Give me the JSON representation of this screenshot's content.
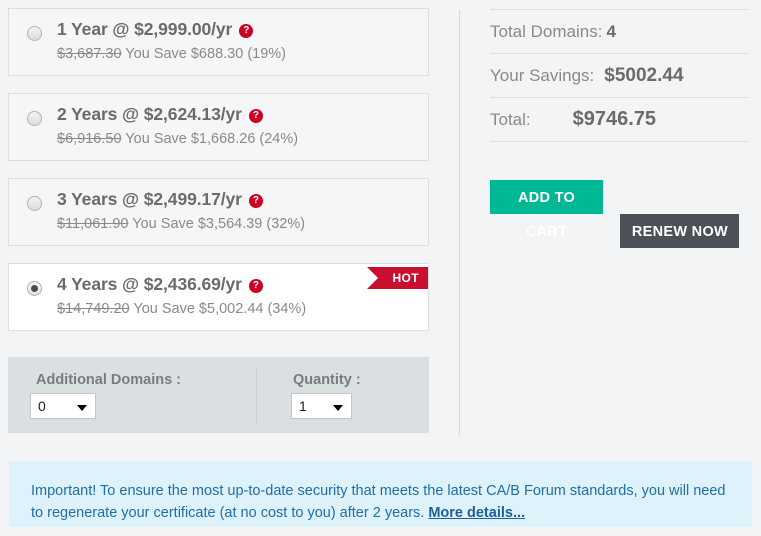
{
  "plans": [
    {
      "term": "1 Year",
      "title": "1 Year @ $2,999.00/yr",
      "old_price": "$3,687.30",
      "savings_text": "You Save $688.30 (19%)",
      "selected": false,
      "badge": null,
      "help_icon": "help-question-icon"
    },
    {
      "term": "2 Years",
      "title": "2 Years @ $2,624.13/yr",
      "old_price": "$6,916.50",
      "savings_text": "You Save $1,668.26 (24%)",
      "selected": false,
      "badge": null,
      "help_icon": "help-question-icon"
    },
    {
      "term": "3 Years",
      "title": "3 Years @ $2,499.17/yr",
      "old_price": "$11,061.90",
      "savings_text": "You Save $3,564.39 (32%)",
      "selected": false,
      "badge": null,
      "help_icon": "help-question-icon"
    },
    {
      "term": "4 Years",
      "title": "4 Years @ $2,436.69/yr",
      "old_price": "$14,749.20",
      "savings_text": "You Save $5,002.44 (34%)",
      "selected": true,
      "badge": "HOT",
      "help_icon": "help-question-icon"
    }
  ],
  "options": {
    "additional_domains_label": "Additional Domains :",
    "additional_domains_value": "0",
    "quantity_label": "Quantity :",
    "quantity_value": "1"
  },
  "summary": {
    "total_domains_label": "Total Domains:",
    "total_domains_value": "4",
    "savings_label": "Your Savings:",
    "savings_value": "$5002.44",
    "total_label": "Total:",
    "total_value": "$9746.75"
  },
  "buttons": {
    "add_to_cart": "ADD TO CART",
    "renew_now": "RENEW NOW"
  },
  "notice": {
    "text": "Important! To ensure the most up-to-date security that meets the latest CA/B Forum standards, you will need to regenerate your certificate (at no cost to you) after 2 years. ",
    "link": "More details..."
  },
  "colors": {
    "accent_green": "#00b894",
    "dark_button": "#4b5157",
    "badge_red": "#c8102e",
    "help_red": "#cc0022",
    "notice_bg": "#ddf2fb",
    "notice_text": "#1f6ea8"
  }
}
